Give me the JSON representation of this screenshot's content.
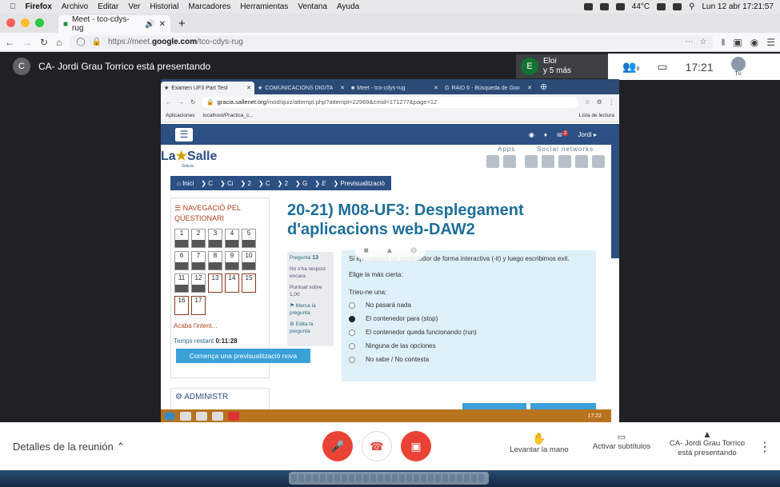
{
  "menubar": {
    "app": "Firefox",
    "items": [
      "Archivo",
      "Editar",
      "Ver",
      "Historial",
      "Marcadores",
      "Herramientas",
      "Ventana",
      "Ayuda"
    ],
    "temp": "44°C",
    "datetime": "Lun 12 abr  17:21:57"
  },
  "firefox": {
    "tab_title": "Meet - tco-cdys-rug",
    "url_prefix": "https://meet.",
    "url_domain": "google.com",
    "url_path": "/tco-cdys-rug"
  },
  "meet": {
    "presenter_initial": "C",
    "presenting_text": "CA- Jordi Grau Torrico está presentando",
    "participant_initial": "E",
    "participant_name": "Eloi",
    "participant_more": "y 5 más",
    "people_count": "8",
    "time": "17:21",
    "self_label": "Tú"
  },
  "chrome": {
    "tabs": [
      "Examen UF3 Part Test",
      "COMUNICACIONS DIGITA",
      "Meet - tco-cdys-rug",
      "RAID 6 - Búsqueda de Goo"
    ],
    "url_domain": "gracia.sallenet.org",
    "url_path": "/mod/quiz/attempt.php?attempt=22969&cmid=171277&page=12",
    "bookmarks": [
      "Aplicaciones",
      "localhost/Practica_c..."
    ],
    "reading_list": "Lista de lectura"
  },
  "moodle": {
    "user": "Jordi",
    "notif_count": "2",
    "logo_a": "La",
    "logo_b": "Salle",
    "logo_sub": "Gràcia",
    "apps_label": "Apps",
    "social_label": "Social networks",
    "breadcrumb": [
      "Inici",
      "C",
      "Ci",
      "2",
      "C",
      "2",
      "G",
      "E",
      "Previsualització"
    ],
    "nav_title": "NAVEGACIÓ PEL QÜESTIONARI",
    "questions_row1": [
      "1",
      "2",
      "3",
      "4",
      "5"
    ],
    "questions_row2": [
      "6",
      "7",
      "8",
      "9",
      "10"
    ],
    "questions_row3": [
      "11",
      "12",
      "13",
      "14",
      "15"
    ],
    "questions_row4": [
      "16",
      "17"
    ],
    "finish_attempt": "Acaba l'intent...",
    "time_left_label": "Temps restant",
    "time_left": "0:11:28",
    "new_preview": "Comença una previsualització nova",
    "admin": "ADMINISTR",
    "page_title": "20-21) M08-UF3: Desplegament d'aplicacions web-DAW2",
    "q_label": "Pregunta",
    "q_number": "13",
    "q_status": "No s'ha respost encara",
    "q_score": "Puntuat sobre 1,00",
    "q_flag": "Marca la pregunta",
    "q_edit": "Edita la pregunta",
    "q_text": "Si ejecutamos un contenedor de forma interactiva (-it) y luego escribimos exit.",
    "q_instruction": "Elige la más cierta:",
    "q_choose": "Trieu-ne una:",
    "options": [
      "No pasará nada",
      "El contenedor para (stop)",
      "El contenedor queda funcionando (run)",
      "Ninguna de las opciones",
      "No sabe / No contesta"
    ],
    "selected_index": 1,
    "win_time": "17:22"
  },
  "controls": {
    "details": "Detalles de la reunión",
    "raise_hand": "Levantar la mano",
    "subtitles": "Activar subtítulos",
    "presenting": "CA- Jordi Grau Torrico está presentando"
  },
  "colors": {
    "mic_off": "#ea4335",
    "moodle_blue": "#2c4f84",
    "title_teal": "#1e6f9a"
  }
}
